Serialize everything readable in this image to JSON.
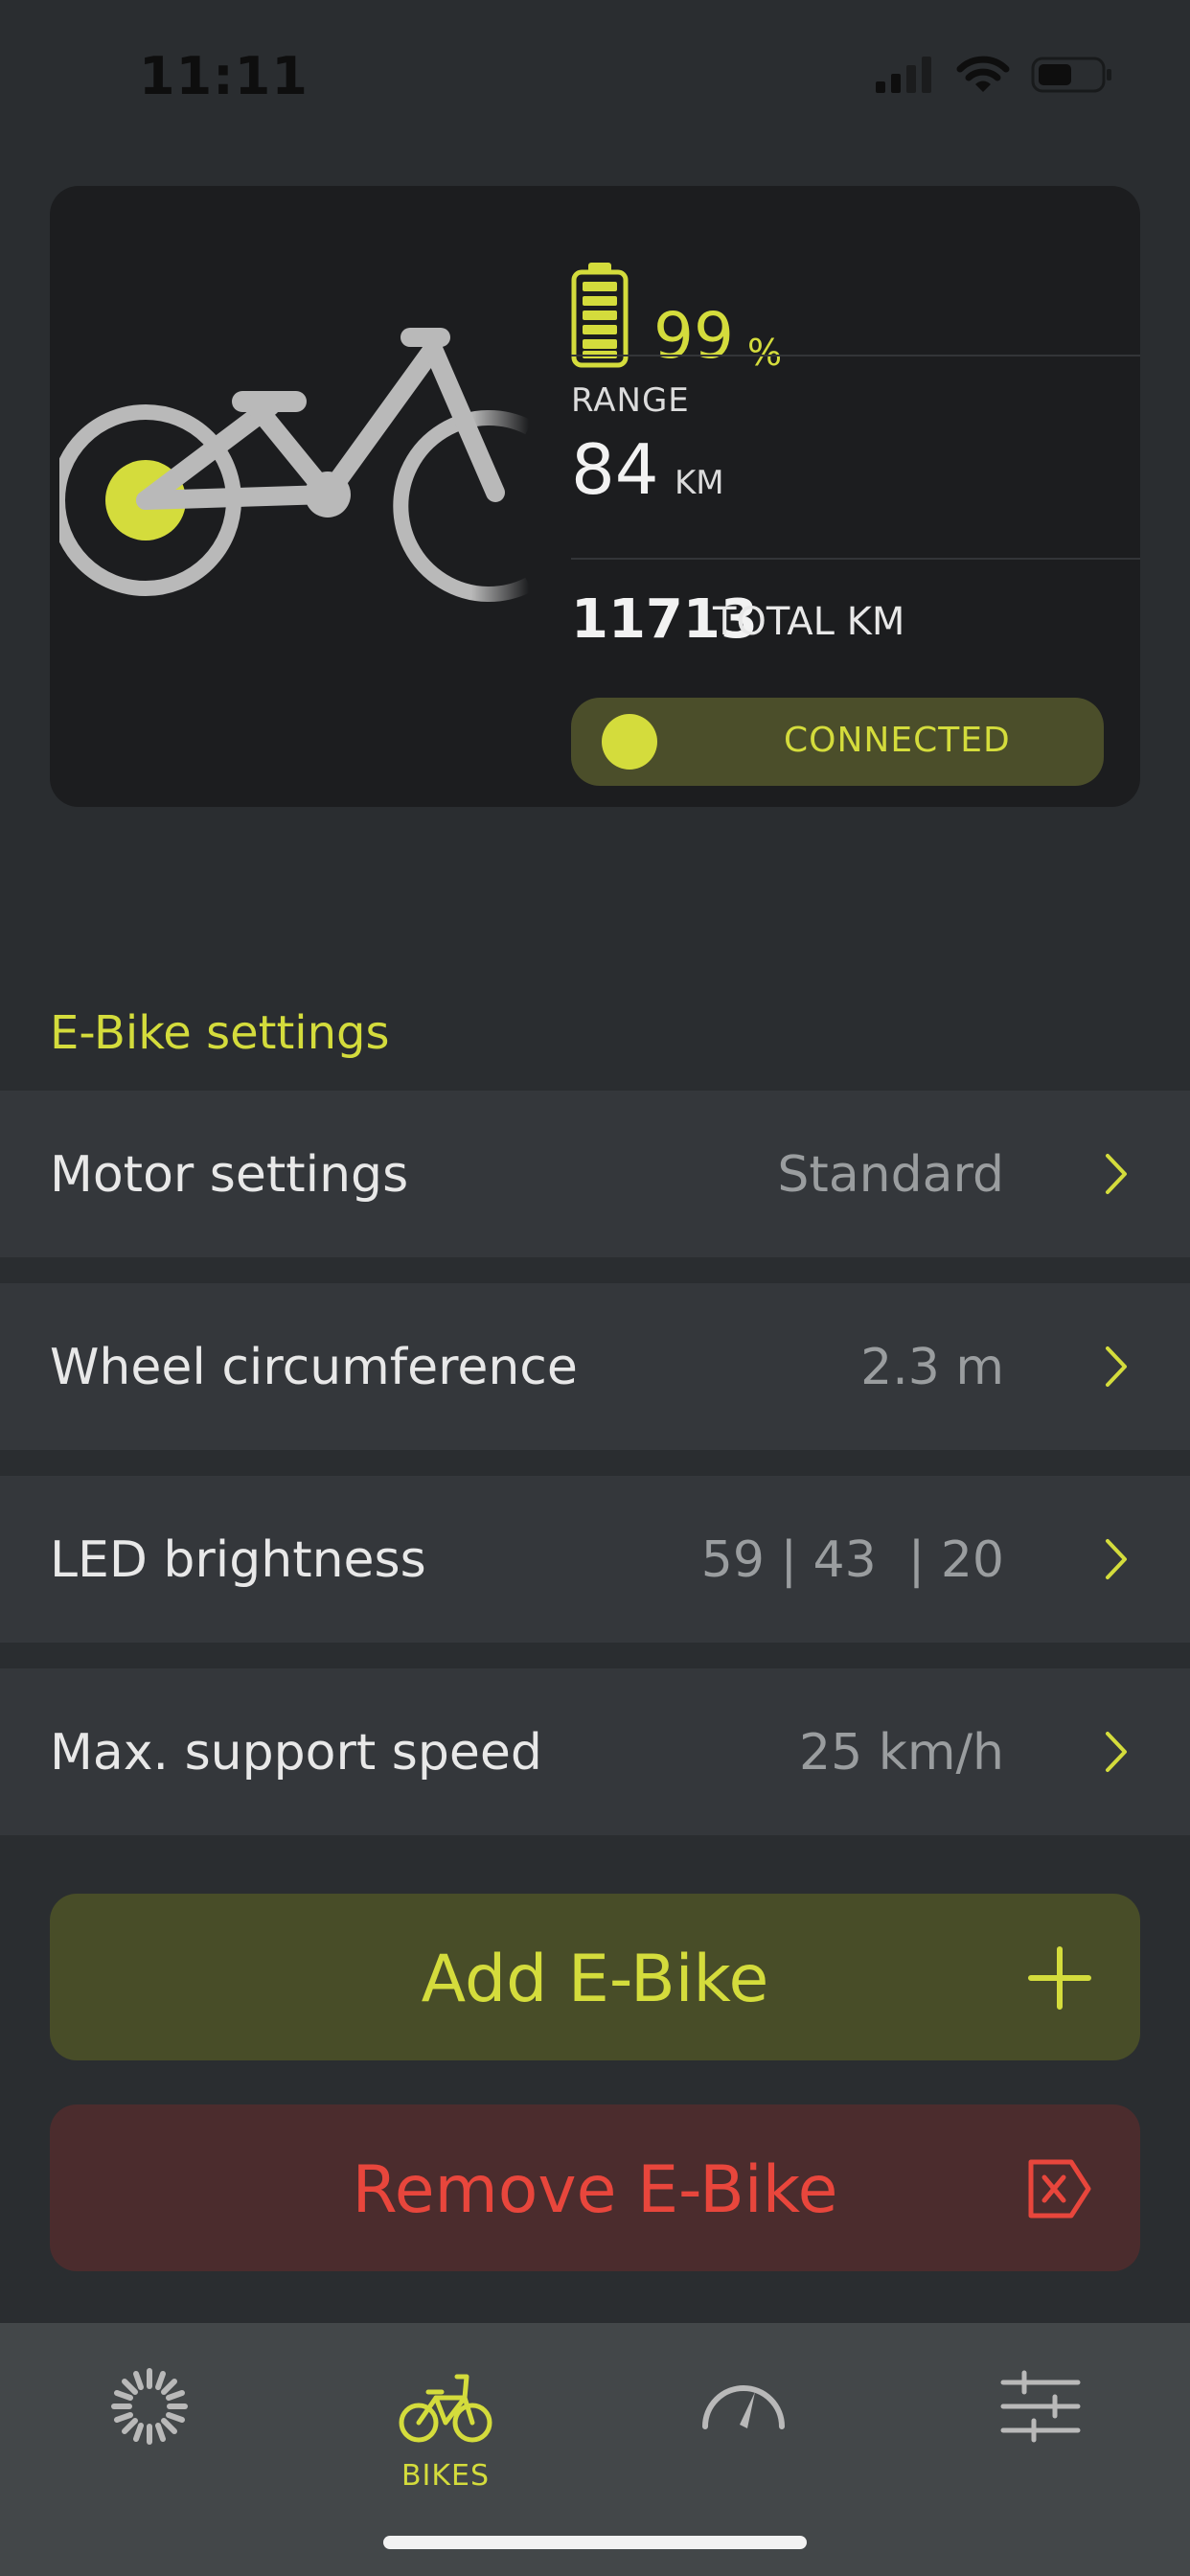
{
  "status_bar": {
    "time": "11:11"
  },
  "bike_card": {
    "battery": {
      "value": "99",
      "unit": "%",
      "level_percent": 99
    },
    "range": {
      "label": "RANGE",
      "value": "84",
      "unit": "KM"
    },
    "total": {
      "value": "11713",
      "unit": "TOTAL KM"
    },
    "connection": {
      "label": "CONNECTED"
    }
  },
  "settings": {
    "title": "E-Bike settings",
    "rows": [
      {
        "label": "Motor settings",
        "value": "Standard"
      },
      {
        "label": "Wheel circumference",
        "value": "2.3 m"
      },
      {
        "label": "LED brightness",
        "value": "59 | 43  | 20"
      },
      {
        "label": "Max. support speed",
        "value": "25 km/h"
      }
    ]
  },
  "actions": {
    "add_label": "Add E-Bike",
    "remove_label": "Remove E-Bike"
  },
  "tab_bar": {
    "tabs": [
      {
        "icon": "loading-icon",
        "label": ""
      },
      {
        "icon": "bike-icon",
        "label": "BIKES"
      },
      {
        "icon": "speedometer-icon",
        "label": ""
      },
      {
        "icon": "sliders-icon",
        "label": ""
      }
    ],
    "active_index": 1
  },
  "colors": {
    "accent": "#d4dc3c",
    "danger": "#e8463c",
    "background": "#2a2d30",
    "card": "#1c1d1f",
    "row": "#34373b"
  }
}
